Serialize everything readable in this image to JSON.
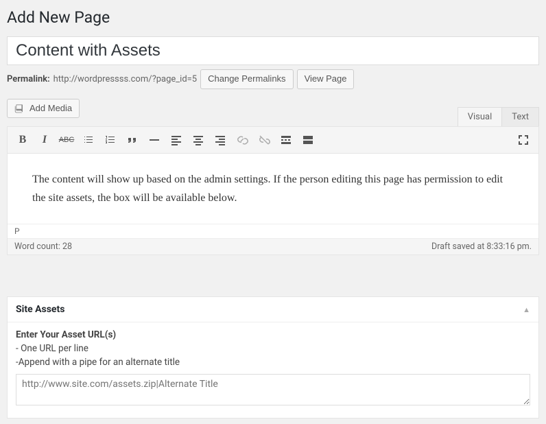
{
  "header": {
    "page_title": "Add New Page"
  },
  "title_field": {
    "value": "Content with Assets"
  },
  "permalink": {
    "label": "Permalink:",
    "url": "http://wordpressss.com/?page_id=5",
    "change_btn": "Change Permalinks",
    "view_btn": "View Page"
  },
  "media": {
    "add_media": "Add Media"
  },
  "tabs": {
    "visual": "Visual",
    "text": "Text"
  },
  "toolbar": {
    "bold": "B",
    "italic": "I",
    "strike": "ABC"
  },
  "content": {
    "text": "The content will show up based on the admin settings. If the person editing this page has permission to edit the site assets, the box will be available below."
  },
  "path": "P",
  "status": {
    "word_count": "Word count: 28",
    "saved": "Draft saved at 8:33:16 pm."
  },
  "assets_box": {
    "title": "Site Assets",
    "heading": "Enter Your Asset URL(s)",
    "line1": "- One URL per line",
    "line2": "-Append with a pipe for an alternate title",
    "placeholder": "http://www.site.com/assets.zip|Alternate Title"
  }
}
